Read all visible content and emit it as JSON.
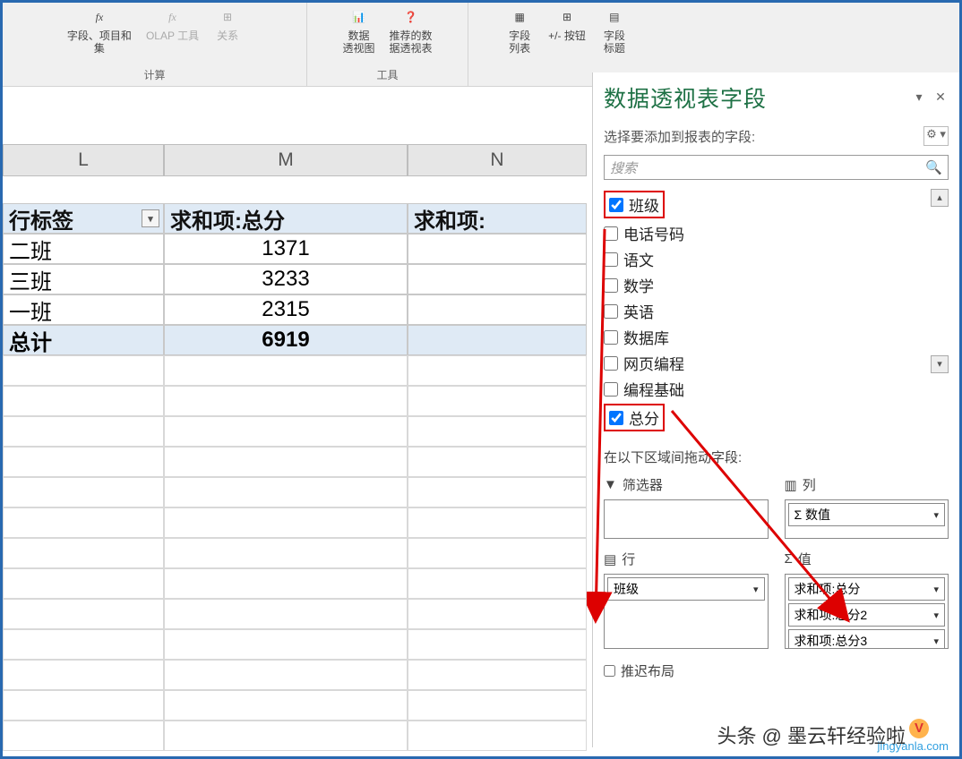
{
  "ribbon": {
    "group_compute": {
      "name": "计算",
      "btn_fields": "字段、项目和\n集",
      "btn_olap": "OLAP 工具",
      "btn_relation": "关系"
    },
    "group_tools": {
      "name": "工具",
      "btn_pivotchart": "数据\n透视图",
      "btn_recommended": "推荐的数\n据透视表"
    },
    "group_show": {
      "btn_fieldlist": "字段\n列表",
      "btn_plusminus": "+/- 按钮",
      "btn_headers": "字段\n标题"
    }
  },
  "columns": {
    "L": "L",
    "M": "M",
    "N": "N"
  },
  "pivot": {
    "header_row_label": "行标签",
    "header_sum1": "求和项:总分",
    "header_sum2": "求和项:",
    "rows": [
      {
        "label": "二班",
        "val": "1371"
      },
      {
        "label": "三班",
        "val": "3233"
      },
      {
        "label": "一班",
        "val": "2315"
      }
    ],
    "total_label": "总计",
    "total_val": "6919"
  },
  "pane": {
    "title": "数据透视表字段",
    "subtitle": "选择要添加到报表的字段:",
    "search_placeholder": "搜索",
    "fields": {
      "banji": "班级",
      "phone": "电话号码",
      "yuwen": "语文",
      "shuxue": "数学",
      "yingyu": "英语",
      "shujuku": "数据库",
      "wangye": "网页编程",
      "bianchen": "编程基础",
      "zongfen": "总分"
    },
    "drag_label": "在以下区域间拖动字段:",
    "zone_filter": "筛选器",
    "zone_cols": "列",
    "zone_rows": "行",
    "zone_vals": "值",
    "col_item": "Σ 数值",
    "row_item": "班级",
    "val_items": [
      "求和项:总分",
      "求和项:总分2",
      "求和项:总分3"
    ],
    "defer": "推迟布局"
  },
  "watermark": "头条 @ 墨云轩经验啦",
  "watermark_url": "jingyanla.com"
}
